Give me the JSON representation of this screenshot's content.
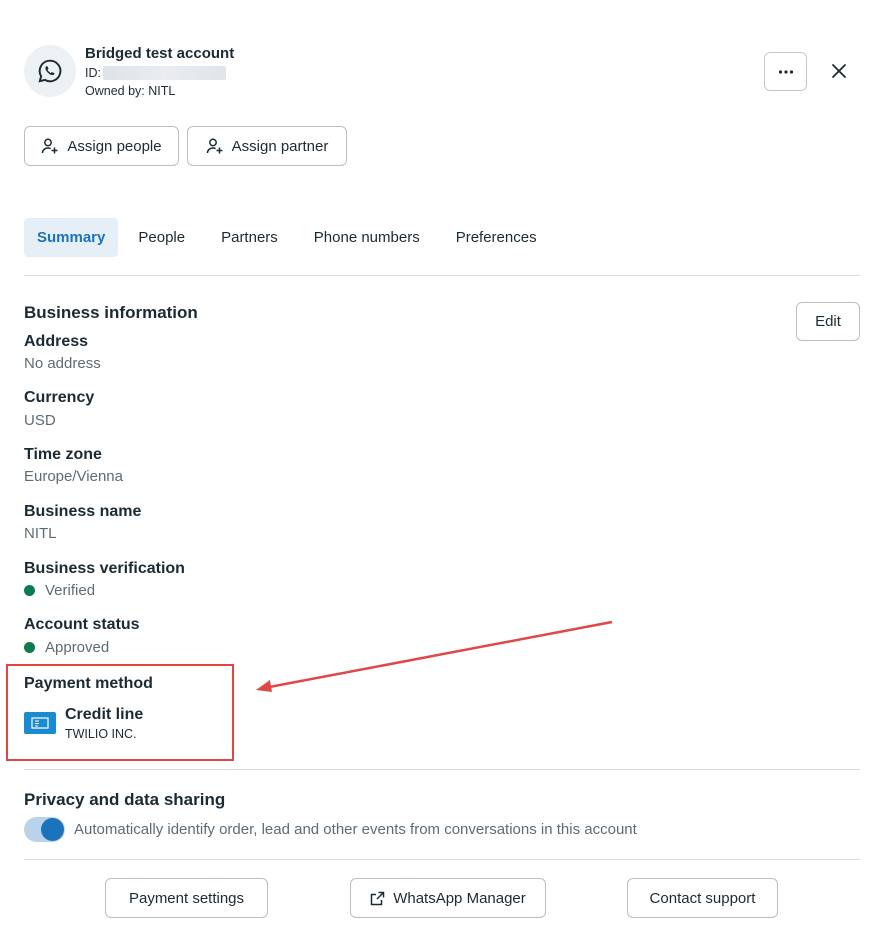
{
  "account": {
    "name": "Bridged test account",
    "id_label": "ID:",
    "owner": "Owned by: NITL"
  },
  "header_buttons": {
    "assign_people": "Assign people",
    "assign_partner": "Assign partner"
  },
  "tabs": [
    {
      "label": "Summary",
      "active": true
    },
    {
      "label": "People",
      "active": false
    },
    {
      "label": "Partners",
      "active": false
    },
    {
      "label": "Phone numbers",
      "active": false
    },
    {
      "label": "Preferences",
      "active": false
    }
  ],
  "business_info": {
    "title": "Business information",
    "edit_label": "Edit",
    "fields": [
      {
        "label": "Address",
        "value": "No address"
      },
      {
        "label": "Currency",
        "value": "USD"
      },
      {
        "label": "Time zone",
        "value": "Europe/Vienna"
      },
      {
        "label": "Business name",
        "value": "NITL"
      },
      {
        "label": "Business verification",
        "value": "Verified"
      },
      {
        "label": "Account status",
        "value": "Approved"
      }
    ]
  },
  "payment": {
    "title": "Payment method",
    "method": "Credit line",
    "provider": "TWILIO INC."
  },
  "privacy": {
    "title": "Privacy and data sharing",
    "toggle_label": "Automatically identify order, lead and other events from conversations in this account",
    "toggle_on": true
  },
  "footer_buttons": {
    "payment_settings": "Payment settings",
    "whatsapp_manager": "WhatsApp Manager",
    "contact_support": "Contact support"
  },
  "colors": {
    "accent": "#1b74bb",
    "status_green": "#0a7a4f",
    "annotation_red": "#e04848",
    "card_blue": "#1b8bd0"
  },
  "icons": [
    "whatsapp-icon",
    "more-icon",
    "close-icon",
    "add-person-icon",
    "credit-card-icon",
    "external-link-icon"
  ]
}
